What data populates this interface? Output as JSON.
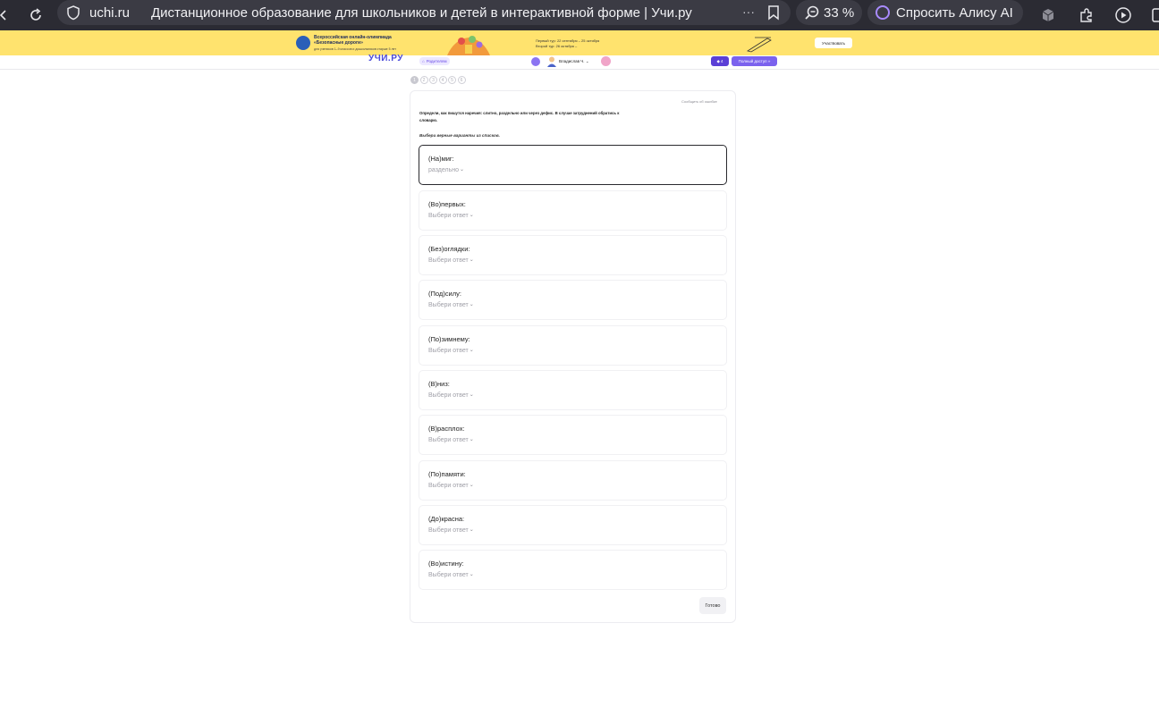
{
  "browser": {
    "host": "uchi.ru",
    "tab_title": "Дистанционное образование для школьников и детей в интерактивной форме | Учи.ру",
    "more_label": "···",
    "zoom": "33 %",
    "alice_label": "Спросить Алису AI"
  },
  "banner": {
    "title": "Всероссийская онлайн-олимпиада «Безопасные дороги»",
    "subtitle": "для учеников 1–9 классов и дошкольников старше 5 лет",
    "dates_line1": "Первый тур: 22 сентября – 25 октября",
    "dates_line2": "Второй тур: 26 октября –",
    "cta": "Участвовать"
  },
  "header": {
    "logo": "УЧИ.РУ",
    "parents": "Родителям",
    "user_name": "Владислав Ч.",
    "premium_badge": "4",
    "full_access": "Полный доступ »"
  },
  "steps": [
    "1",
    "2",
    "3",
    "4",
    "5",
    "6"
  ],
  "exercise": {
    "report_link": "Сообщить об ошибке",
    "instruction": "Определи, как пишутся наречия: слитно, раздельно или через дефис. В случае затруднений обратись к словарю.",
    "hint": "Выбери верные варианты из списков.",
    "questions": [
      {
        "label": "(На)миг:",
        "answer": "раздельно"
      },
      {
        "label": "(Во)первых:",
        "answer": "Выбери ответ"
      },
      {
        "label": "(Без)оглядки:",
        "answer": "Выбери ответ"
      },
      {
        "label": "(Под)силу:",
        "answer": "Выбери ответ"
      },
      {
        "label": "(По)зимнему:",
        "answer": "Выбери ответ"
      },
      {
        "label": "(В)низ:",
        "answer": "Выбери ответ"
      },
      {
        "label": "(В)расплох:",
        "answer": "Выбери ответ"
      },
      {
        "label": "(По)памяти:",
        "answer": "Выбери ответ"
      },
      {
        "label": "(До)красна:",
        "answer": "Выбери ответ"
      },
      {
        "label": "(Во)истину:",
        "answer": "Выбери ответ"
      }
    ],
    "done": "Готово"
  },
  "colors": {
    "browser_bg": "#2b2b33",
    "banner_bg": "#ffe36e",
    "accent": "#7b62ee"
  }
}
